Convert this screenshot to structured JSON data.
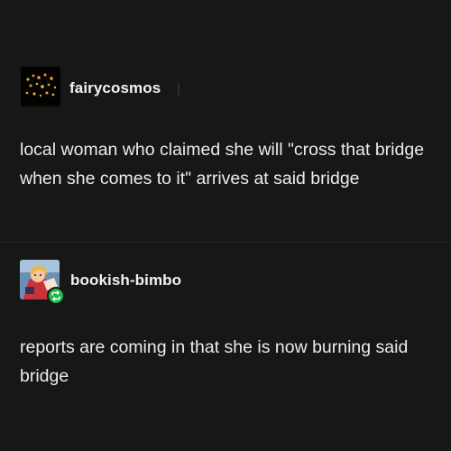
{
  "posts": [
    {
      "username": "fairycosmos",
      "text": "local woman who claimed she will \"cross that bridge when she comes to it\" arrives at said bridge",
      "avatar_icon": "chandelier-avatar-icon"
    },
    {
      "username": "bookish-bimbo",
      "text": "reports are coming in that she is now burning said bridge",
      "avatar_icon": "cartoon-avatar-icon",
      "badge_icon": "reblog-icon"
    }
  ],
  "colors": {
    "background": "#171717",
    "text": "#ececec",
    "reblog_badge": "#1fb84b"
  }
}
